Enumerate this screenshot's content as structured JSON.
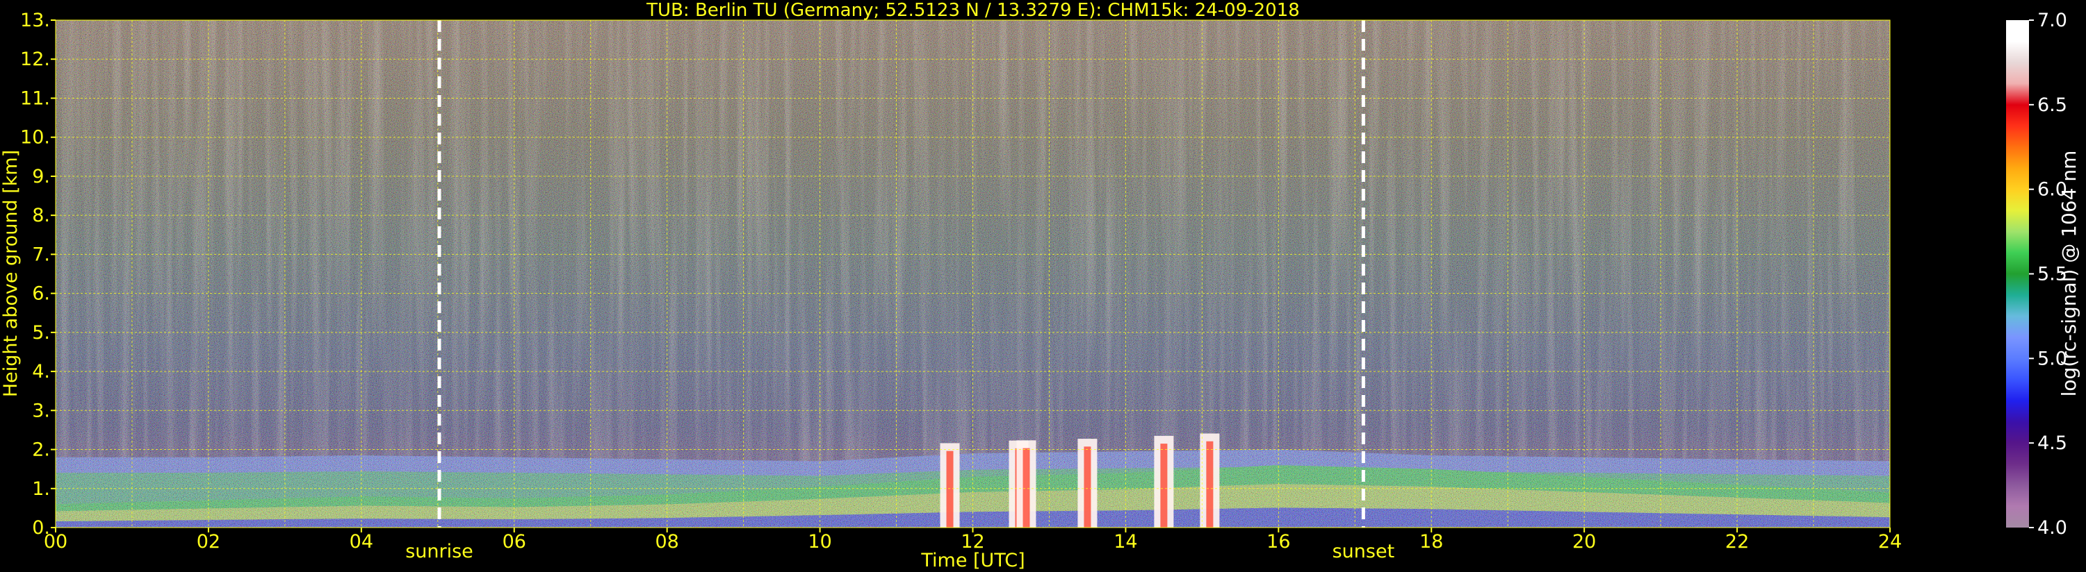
{
  "chart_data": {
    "type": "heatmap",
    "title": "TUB: Berlin TU (Germany; 52.5123 N / 13.3279 E):    CHM15k: 24-09-2018",
    "xlabel": "Time [UTC]",
    "ylabel": "Height above ground [km]",
    "xlim": [
      0,
      24
    ],
    "ylim": [
      0,
      13
    ],
    "x_ticks": [
      {
        "value": 0,
        "label": "00"
      },
      {
        "value": 2,
        "label": "02"
      },
      {
        "value": 4,
        "label": "04"
      },
      {
        "value": 6,
        "label": "06"
      },
      {
        "value": 8,
        "label": "08"
      },
      {
        "value": 10,
        "label": "10"
      },
      {
        "value": 12,
        "label": "12"
      },
      {
        "value": 14,
        "label": "14"
      },
      {
        "value": 16,
        "label": "16"
      },
      {
        "value": 18,
        "label": "18"
      },
      {
        "value": 20,
        "label": "20"
      },
      {
        "value": 22,
        "label": "22"
      },
      {
        "value": 24,
        "label": "24"
      }
    ],
    "y_ticks": [
      {
        "value": 0,
        "label": "0."
      },
      {
        "value": 1,
        "label": "1."
      },
      {
        "value": 2,
        "label": "2."
      },
      {
        "value": 3,
        "label": "3."
      },
      {
        "value": 4,
        "label": "4."
      },
      {
        "value": 5,
        "label": "5."
      },
      {
        "value": 6,
        "label": "6."
      },
      {
        "value": 7,
        "label": "7."
      },
      {
        "value": 8,
        "label": "8."
      },
      {
        "value": 9,
        "label": "9."
      },
      {
        "value": 10,
        "label": "10."
      },
      {
        "value": 11,
        "label": "11."
      },
      {
        "value": 12,
        "label": "12."
      },
      {
        "value": 13,
        "label": "13."
      }
    ],
    "grid": true,
    "markers": [
      {
        "label": "sunrise",
        "time": 5.02
      },
      {
        "label": "sunset",
        "time": 17.11
      }
    ],
    "colorbar": {
      "label": "log(rc-signal) @ 1064 nm",
      "range": [
        4.0,
        7.0
      ],
      "ticks": [
        {
          "value": 4.0,
          "label": "4.0"
        },
        {
          "value": 4.5,
          "label": "4.5"
        },
        {
          "value": 5.0,
          "label": "5.0"
        },
        {
          "value": 5.5,
          "label": "5.5"
        },
        {
          "value": 6.0,
          "label": "6.0"
        },
        {
          "value": 6.5,
          "label": "6.5"
        },
        {
          "value": 7.0,
          "label": "7.0"
        }
      ],
      "colors": [
        "#a58aa5",
        "#b07ab0",
        "#8e5a9e",
        "#6e2d8a",
        "#55158a",
        "#3a10aa",
        "#2020ee",
        "#3a55ff",
        "#5b7cff",
        "#7a95ff",
        "#66bbdd",
        "#1fae95",
        "#22a030",
        "#3fcf55",
        "#9fe36a",
        "#e6f03a",
        "#ffd020",
        "#ffaa10",
        "#ff7010",
        "#ff3018",
        "#e00010",
        "#f0b0b0",
        "#e8d8d8",
        "#ffffff",
        "#ffffff"
      ]
    },
    "boundary_layer_top_km": [
      [
        0,
        1.8
      ],
      [
        2,
        1.8
      ],
      [
        4,
        1.85
      ],
      [
        6,
        1.8
      ],
      [
        8,
        1.75
      ],
      [
        10,
        1.7
      ],
      [
        12,
        1.9
      ],
      [
        14,
        1.95
      ],
      [
        16,
        2.0
      ],
      [
        18,
        1.85
      ],
      [
        20,
        1.8
      ],
      [
        22,
        1.75
      ],
      [
        24,
        1.7
      ]
    ],
    "aerosol_layer_top_km": [
      [
        0,
        0.6
      ],
      [
        2,
        0.7
      ],
      [
        4,
        0.8
      ],
      [
        6,
        0.75
      ],
      [
        8,
        0.85
      ],
      [
        10,
        1.05
      ],
      [
        12,
        1.3
      ],
      [
        14,
        1.4
      ],
      [
        16,
        1.6
      ],
      [
        18,
        1.5
      ],
      [
        20,
        1.3
      ],
      [
        22,
        1.1
      ],
      [
        24,
        0.9
      ]
    ]
  }
}
